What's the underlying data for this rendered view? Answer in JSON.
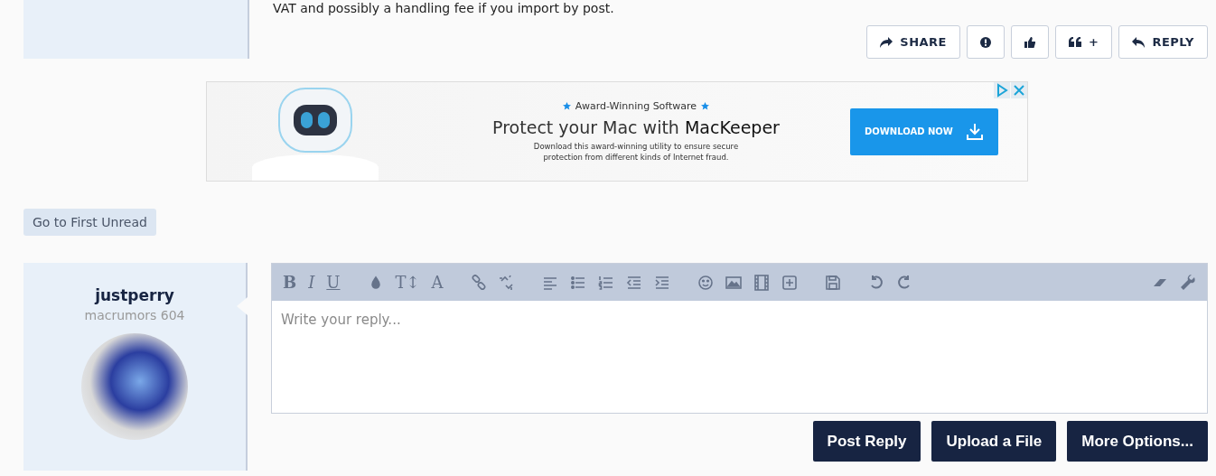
{
  "previous_post": {
    "text": "VAT and possibly a handling fee if you import by post.",
    "actions": [
      {
        "kind": "share",
        "label": "SHARE"
      },
      {
        "kind": "report"
      },
      {
        "kind": "like"
      },
      {
        "kind": "quote",
        "label": "+"
      },
      {
        "kind": "reply",
        "label": "REPLY"
      }
    ]
  },
  "ad": {
    "tagline": "Award-Winning Software",
    "headline": "Protect your Mac with **MacKeeper**",
    "body": "Download this award-winning utility to ensure secure protection from different kinds of Internet fraud.",
    "cta": "DOWNLOAD NOW"
  },
  "first_unread": "Go to First Unread",
  "reply_form": {
    "user": {
      "name": "justperry",
      "title": "macrumors 604"
    },
    "toolbar": [
      {
        "kind": "bold",
        "label": "B"
      },
      {
        "kind": "italic",
        "label": "I"
      },
      {
        "kind": "underline",
        "label": "U"
      },
      {
        "kind": "drop"
      },
      {
        "kind": "size",
        "label": "T↕"
      },
      {
        "kind": "font",
        "label": "A"
      },
      {
        "kind": "link"
      },
      {
        "kind": "unlink"
      },
      {
        "kind": "align"
      },
      {
        "kind": "bullets"
      },
      {
        "kind": "numbers"
      },
      {
        "kind": "outdent"
      },
      {
        "kind": "indent"
      },
      {
        "kind": "smiley"
      },
      {
        "kind": "image"
      },
      {
        "kind": "film"
      },
      {
        "kind": "plus"
      },
      {
        "kind": "save"
      },
      {
        "kind": "undo"
      },
      {
        "kind": "redo"
      }
    ],
    "toolbar_right": [
      {
        "kind": "eraser"
      },
      {
        "kind": "wrench"
      }
    ],
    "placeholder": "Write your reply...",
    "buttons": [
      "Post Reply",
      "Upload a File",
      "More Options..."
    ]
  }
}
